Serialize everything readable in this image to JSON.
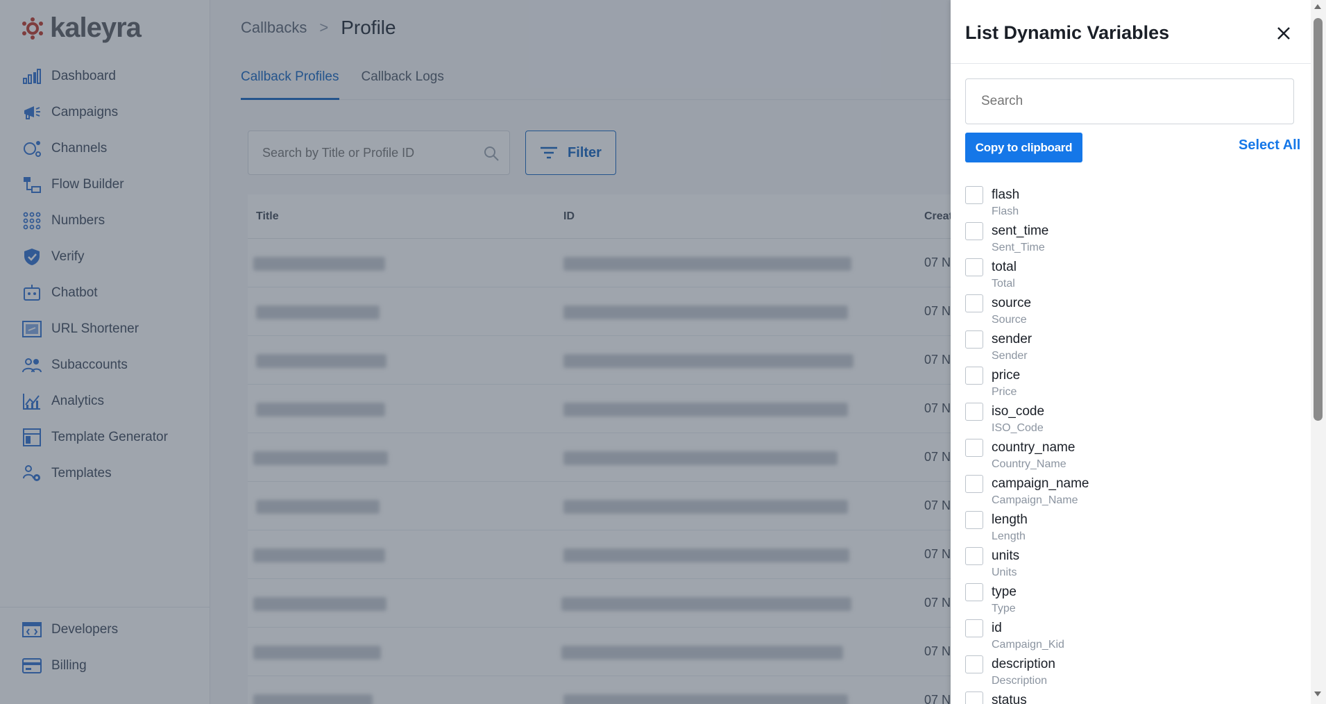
{
  "app": {
    "brand": "kaleyra"
  },
  "sidebar": {
    "items": [
      {
        "label": "Dashboard",
        "icon": "bar-chart-icon"
      },
      {
        "label": "Campaigns",
        "icon": "megaphone-icon"
      },
      {
        "label": "Channels",
        "icon": "channels-icon"
      },
      {
        "label": "Flow Builder",
        "icon": "flow-icon"
      },
      {
        "label": "Numbers",
        "icon": "dialpad-icon"
      },
      {
        "label": "Verify",
        "icon": "shield-icon"
      },
      {
        "label": "Chatbot",
        "icon": "chatbot-icon"
      },
      {
        "label": "URL Shortener",
        "icon": "link-icon"
      },
      {
        "label": "Subaccounts",
        "icon": "users-icon"
      },
      {
        "label": "Analytics",
        "icon": "analytics-icon"
      },
      {
        "label": "Template Generator",
        "icon": "layout-icon"
      },
      {
        "label": "Templates",
        "icon": "templates-icon"
      }
    ],
    "bottom_items": [
      {
        "label": "Developers",
        "icon": "code-icon"
      },
      {
        "label": "Billing",
        "icon": "card-icon"
      }
    ]
  },
  "breadcrumb": {
    "parent": "Callbacks",
    "separator": ">",
    "current": "Profile"
  },
  "tabs": [
    {
      "label": "Callback Profiles",
      "active": true
    },
    {
      "label": "Callback Logs",
      "active": false
    }
  ],
  "search": {
    "placeholder": "Search by Title or Profile ID"
  },
  "filter": {
    "label": "Filter"
  },
  "table": {
    "headers": {
      "title": "Title",
      "id": "ID",
      "created": "Create"
    },
    "row_date": "07 N"
  },
  "drawer": {
    "title": "List Dynamic Variables",
    "search_placeholder": "Search",
    "copy_label": "Copy to clipboard",
    "select_all_label": "Select All",
    "variables": [
      {
        "name": "flash",
        "label": "Flash"
      },
      {
        "name": "sent_time",
        "label": "Sent_Time"
      },
      {
        "name": "total",
        "label": "Total"
      },
      {
        "name": "source",
        "label": "Source"
      },
      {
        "name": "sender",
        "label": "Sender"
      },
      {
        "name": "price",
        "label": "Price"
      },
      {
        "name": "iso_code",
        "label": "ISO_Code"
      },
      {
        "name": "country_name",
        "label": "Country_Name"
      },
      {
        "name": "campaign_name",
        "label": "Campaign_Name"
      },
      {
        "name": "length",
        "label": "Length"
      },
      {
        "name": "units",
        "label": "Units"
      },
      {
        "name": "type",
        "label": "Type"
      },
      {
        "name": "id",
        "label": "Campaign_Kid"
      },
      {
        "name": "description",
        "label": "Description"
      },
      {
        "name": "status",
        "label": ""
      }
    ]
  },
  "colors": {
    "accent": "#1577e8",
    "overlay": "#374254"
  }
}
